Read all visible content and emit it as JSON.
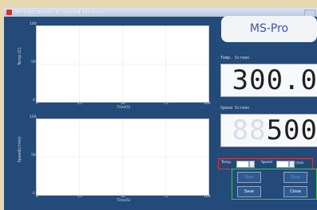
{
  "window": {
    "title": "Temperature & Speed Monitor"
  },
  "brand": {
    "label": "MS-Pro"
  },
  "temp_screen": {
    "label": "Temp. Screen",
    "value": "300.0"
  },
  "speed_screen": {
    "label": "Speed Screen",
    "value_ghost": "88",
    "value": "500"
  },
  "chart_top": {
    "ylabel": "Temp.(C)",
    "xlabel": "Time(S)",
    "y_ticks": [
      "100",
      "50",
      "0"
    ],
    "x_ticks": [
      "0",
      "25",
      "50",
      "75",
      "100"
    ]
  },
  "chart_bottom": {
    "ylabel": "Speed(r/min)",
    "xlabel": "Time(S)",
    "y_ticks": [
      "100",
      "50",
      "0"
    ],
    "x_ticks": [
      "0",
      "25",
      "50",
      "75",
      "100"
    ]
  },
  "params": {
    "temp_label": "Temp.",
    "speed_label": "Speed",
    "speed_unit": "r/min"
  },
  "controls": {
    "start": "Start",
    "stop": "Stop",
    "save": "Save",
    "close": "Close"
  },
  "colors": {
    "panel_bg": "#234a78",
    "params_border": "#d33b3b",
    "controls_border": "#3fc94a",
    "brand_text": "#3a57a6"
  }
}
